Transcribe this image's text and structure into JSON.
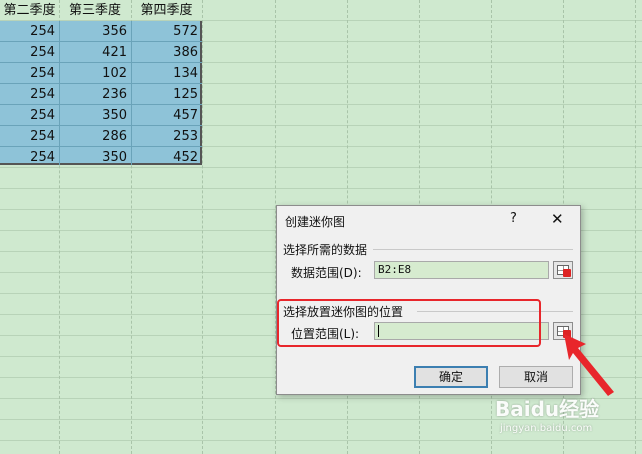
{
  "sheet": {
    "headers": [
      "第二季度",
      "第三季度",
      "第四季度"
    ],
    "rows": [
      [
        "254",
        "356",
        "572"
      ],
      [
        "254",
        "421",
        "386"
      ],
      [
        "254",
        "102",
        "134"
      ],
      [
        "254",
        "236",
        "125"
      ],
      [
        "254",
        "350",
        "457"
      ],
      [
        "254",
        "286",
        "253"
      ],
      [
        "254",
        "350",
        "452"
      ]
    ]
  },
  "dialog": {
    "title": "创建迷你图",
    "help": "?",
    "close": "✕",
    "data_group_label": "选择所需的数据",
    "data_range_label": "数据范围(D):",
    "data_range_value": "B2:E8",
    "location_group_label": "选择放置迷你图的位置",
    "location_range_label": "位置范围(L):",
    "location_range_value": "",
    "ok_label": "确定",
    "cancel_label": "取消"
  },
  "watermark": {
    "text": "Baidu经验",
    "sub": "jingyan.baidu.com"
  },
  "colors": {
    "selection": "#8ec3d8",
    "highlight": "#e8262b",
    "sheet_bg": "#cfe9cf"
  }
}
